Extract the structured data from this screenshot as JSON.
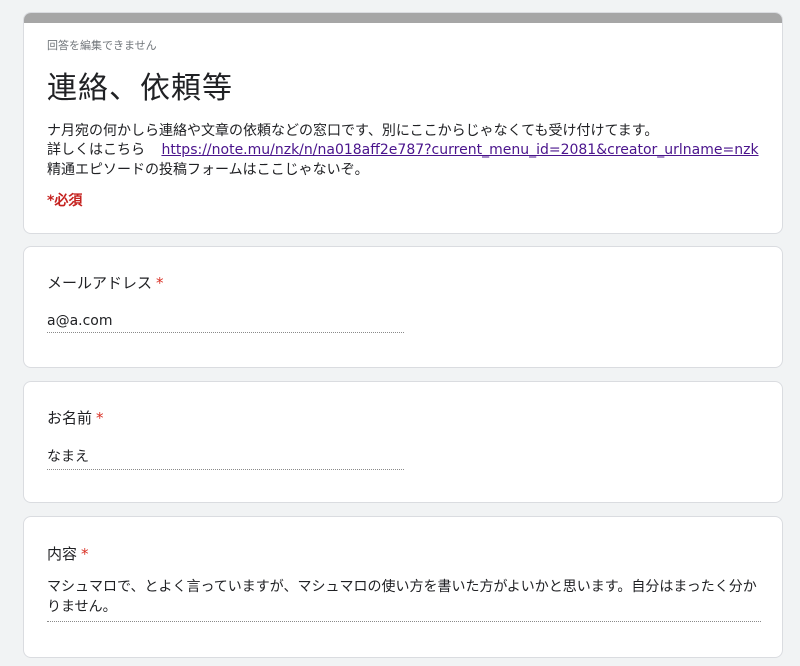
{
  "colors": {
    "top_band": "#a6a6a6",
    "required": "#d93025",
    "link": "#4a148c",
    "background": "#f1f3f4"
  },
  "header": {
    "not_editable": "回答を編集できません",
    "title": "連絡、依頼等",
    "description_line1": "ナ月宛の何かしら連絡や文章の依頼などの窓口です、別にここからじゃなくても受け付けてます。",
    "description_line2_prefix": "詳しくはこちら",
    "description_link": "https://note.mu/nzk/n/na018aff2e787?current_menu_id=2081&creator_urlname=nzk",
    "description_line3": "精通エピソードの投稿フォームはここじゃないぞ。",
    "required_note": "*必須"
  },
  "questions": [
    {
      "label": "メールアドレス",
      "required_mark": "*",
      "answer": "a@a.com"
    },
    {
      "label": "お名前",
      "required_mark": "*",
      "answer": "なまえ"
    },
    {
      "label": "内容",
      "required_mark": "*",
      "answer": "マシュマロで、とよく言っていますが、マシュマロの使い方を書いた方がよいかと思います。自分はまったく分かりません。"
    }
  ]
}
